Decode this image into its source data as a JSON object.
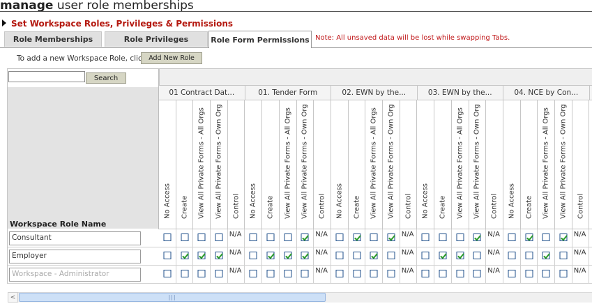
{
  "title": {
    "bold": "manage",
    "rest": " user role memberships"
  },
  "section_heading": "Set Workspace Roles, Privileges & Permissions",
  "tabs": [
    {
      "label": "Role Memberships",
      "active": false
    },
    {
      "label": "Role Privileges",
      "active": false
    },
    {
      "label": "Role Form Permissions",
      "active": true
    }
  ],
  "note": "Note: All unsaved data will be lost while swapping Tabs.",
  "instruction": "To add a new Workspace Role, click",
  "add_button": "Add New Role",
  "search": {
    "value": "",
    "button": "Search"
  },
  "role_column_header": "Workspace Role Name",
  "groups": [
    "01 Contract Dat...",
    "01. Tender Form",
    "02. EWN by the...",
    "03. EWN by the...",
    "04. NCE by Con..."
  ],
  "columns": [
    "No Access",
    "Create",
    "View All Private Forms - All Orgs",
    "View All Private Forms - Own Org",
    "Control"
  ],
  "na_label": "N/A",
  "rows": [
    {
      "name": "Consultant",
      "dim": false,
      "groups": [
        [
          0,
          0,
          0,
          0
        ],
        [
          0,
          0,
          0,
          1
        ],
        [
          0,
          1,
          0,
          1
        ],
        [
          0,
          0,
          0,
          1
        ],
        [
          0,
          1,
          0,
          1
        ]
      ]
    },
    {
      "name": "Employer",
      "dim": false,
      "groups": [
        [
          0,
          1,
          1,
          1
        ],
        [
          0,
          1,
          1,
          1
        ],
        [
          0,
          0,
          1,
          0
        ],
        [
          0,
          1,
          1,
          0
        ],
        [
          0,
          0,
          1,
          0
        ]
      ]
    },
    {
      "name": "Workspace - Administrator",
      "dim": true,
      "groups": [
        [
          0,
          0,
          0,
          0
        ],
        [
          0,
          0,
          0,
          0
        ],
        [
          0,
          0,
          0,
          0
        ],
        [
          0,
          0,
          0,
          0
        ],
        [
          0,
          0,
          0,
          0
        ]
      ]
    }
  ],
  "scrollbar": {
    "left_arrow": "<",
    "grip": "|||"
  }
}
